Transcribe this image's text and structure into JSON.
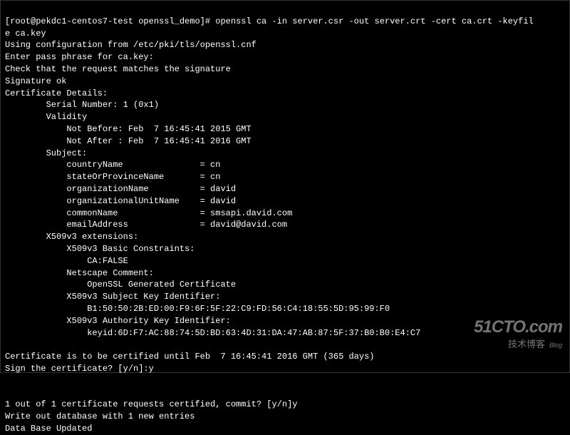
{
  "prompt": "[root@pekdc1-centos7-test openssl_demo]# ",
  "command": "openssl ca -in server.csr -out server.crt -cert ca.crt -keyfil",
  "command_wrap": "e ca.key",
  "lines": {
    "cfg": "Using configuration from /etc/pki/tls/openssl.cnf",
    "pass": "Enter pass phrase for ca.key:",
    "chk": "Check that the request matches the signature",
    "sigok": "Signature ok",
    "cd": "Certificate Details:",
    "sn": "        Serial Number: 1 (0x1)",
    "val": "        Validity",
    "nb": "            Not Before: Feb  7 16:45:41 2015 GMT",
    "na": "            Not After : Feb  7 16:45:41 2016 GMT",
    "subj": "        Subject:",
    "cn": "            countryName               = cn",
    "st": "            stateOrProvinceName       = cn",
    "org": "            organizationName          = david",
    "ou": "            organizationalUnitName    = david",
    "cmn": "            commonName                = smsapi.david.com",
    "em": "            emailAddress              = david@david.com",
    "x509": "        X509v3 extensions:",
    "bc": "            X509v3 Basic Constraints: ",
    "caf": "                CA:FALSE",
    "nc": "            Netscape Comment: ",
    "ogc": "                OpenSSL Generated Certificate",
    "ski": "            X509v3 Subject Key Identifier: ",
    "skiv": "                B1:50:50:2B:ED:00:F9:6F:5F:22:C9:FD:56:C4:18:55:5D:95:99:F0",
    "aki": "            X509v3 Authority Key Identifier: ",
    "akiv": "                keyid:6D:F7:AC:88:74:5D:BD:63:4D:31:DA:47:AB:87:5F:37:B0:B0:E4:C7",
    "blank": "",
    "until": "Certificate is to be certified until Feb  7 16:45:41 2016 GMT (365 days)",
    "sign": "Sign the certificate? [y/n]:y",
    "blank2": "",
    "blank3": "",
    "commit": "1 out of 1 certificate requests certified, commit? [y/n]y",
    "wr": "Write out database with 1 new entries",
    "dbu": "Data Base Updated"
  },
  "watermark": {
    "brand": "51CTO.com",
    "sub": "技术博客",
    "blog": "Blog"
  }
}
